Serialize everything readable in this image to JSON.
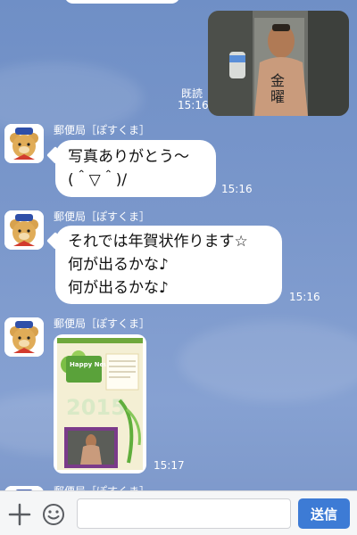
{
  "messages": {
    "sent_photo": {
      "read_label": "既読",
      "time": "15:16"
    },
    "received": [
      {
        "sender": "郵便局［ぽすくま］",
        "lines": [
          "写真ありがとう〜",
          "(＾▽＾)/"
        ],
        "time": "15:16"
      },
      {
        "sender": "郵便局［ぽすくま］",
        "lines": [
          "それでは年賀状作ります☆",
          "何が出るかな♪",
          "何が出るかな♪"
        ],
        "time": "15:16"
      },
      {
        "sender": "郵便局［ぽすくま］",
        "card_text": {
          "greeting": "Happy New Year!",
          "year": "2015"
        },
        "time": "15:17"
      },
      {
        "sender": "郵便局［ぽすくま］"
      }
    ]
  },
  "footer": {
    "input_placeholder": "",
    "send_label": "送信"
  },
  "icons": {
    "add": "plus-icon",
    "emoji": "smiley-icon"
  }
}
